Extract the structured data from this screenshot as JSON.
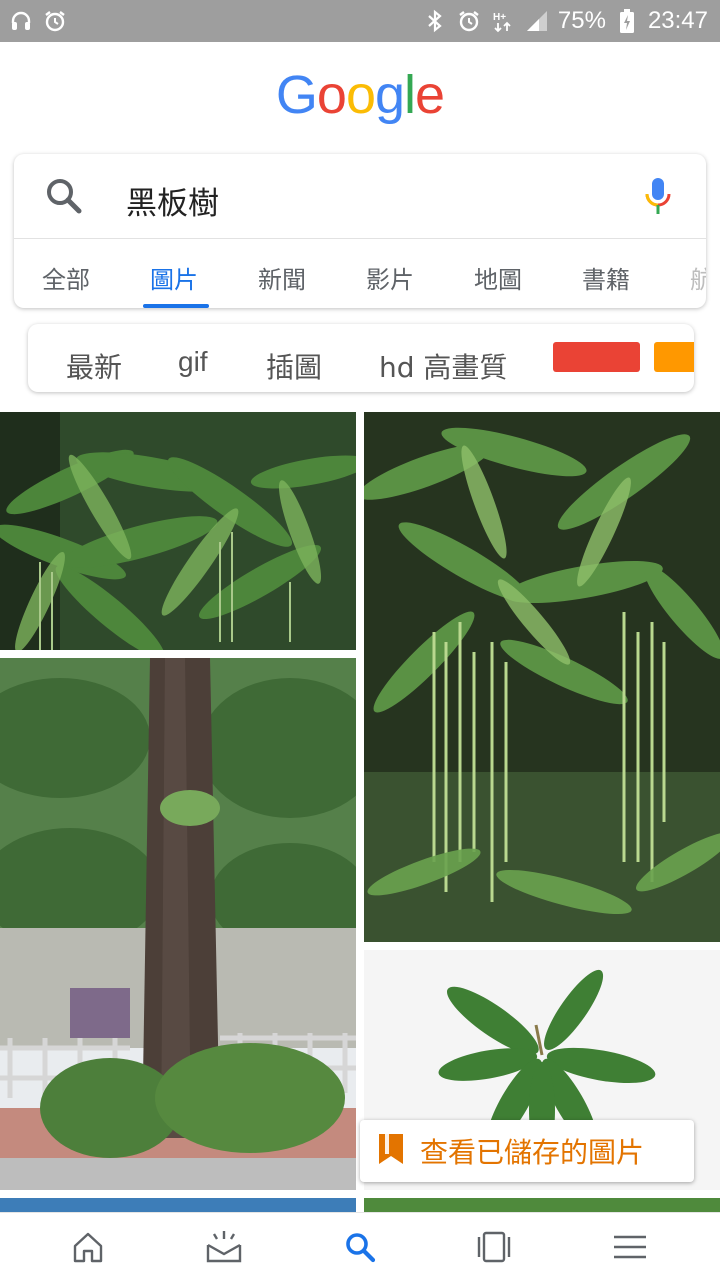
{
  "status_bar": {
    "battery": "75%",
    "time": "23:47",
    "left_icons": [
      "headphones-icon",
      "alarm-icon"
    ],
    "right_icons": [
      "bluetooth-icon",
      "alarm-icon",
      "network-h-plus-icon",
      "signal-icon",
      "battery-charging-icon"
    ]
  },
  "logo": {
    "letters": [
      "G",
      "o",
      "o",
      "g",
      "l",
      "e"
    ],
    "colors": [
      "#4285F4",
      "#EA4335",
      "#FBBC05",
      "#4285F4",
      "#34A853",
      "#EA4335"
    ]
  },
  "search": {
    "query": "黑板樹"
  },
  "tabs": [
    {
      "label": "全部",
      "active": false
    },
    {
      "label": "圖片",
      "active": true
    },
    {
      "label": "新聞",
      "active": false
    },
    {
      "label": "影片",
      "active": false
    },
    {
      "label": "地圖",
      "active": false
    },
    {
      "label": "書籍",
      "active": false
    },
    {
      "label": "航",
      "active": false
    }
  ],
  "chips": [
    {
      "label": "最新"
    },
    {
      "label": "gif"
    },
    {
      "label": "插圖"
    },
    {
      "label": "hd 高畫質"
    }
  ],
  "color_chips": [
    "#ea4335",
    "#ff9800"
  ],
  "saved_button": {
    "label": "查看已儲存的圖片",
    "color": "#e37400"
  },
  "bottom_nav": [
    "home-icon",
    "inbox-icon",
    "search-icon",
    "tabs-icon",
    "menu-icon"
  ],
  "accent": "#1a73e8"
}
